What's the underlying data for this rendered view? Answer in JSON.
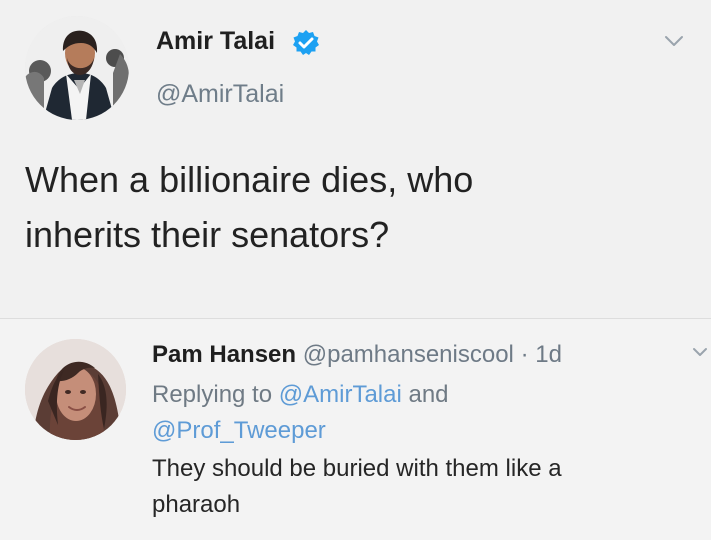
{
  "tweet": {
    "display_name": "Amir Talai",
    "handle": "@AmirTalai",
    "text_line_1": "When a billionaire dies, who",
    "text_line_2": "inherits their senators?"
  },
  "reply": {
    "display_name": "Pam Hansen",
    "handle": "@pamhanseniscool",
    "separator": "·",
    "time": "1d",
    "replying_prefix": "Replying to",
    "replying_to_1": "@AmirTalai",
    "replying_connector": "and",
    "replying_to_2": "@Prof_Tweeper",
    "text_line_1": "They should be buried with them like a",
    "text_line_2": "pharaoh"
  },
  "icons": {
    "verified": "verified-badge-icon",
    "menu": "chevron-down-icon"
  },
  "colors": {
    "verified": "#1da1f2",
    "mention": "#5e9bd6",
    "muted": "#6f7a84"
  }
}
